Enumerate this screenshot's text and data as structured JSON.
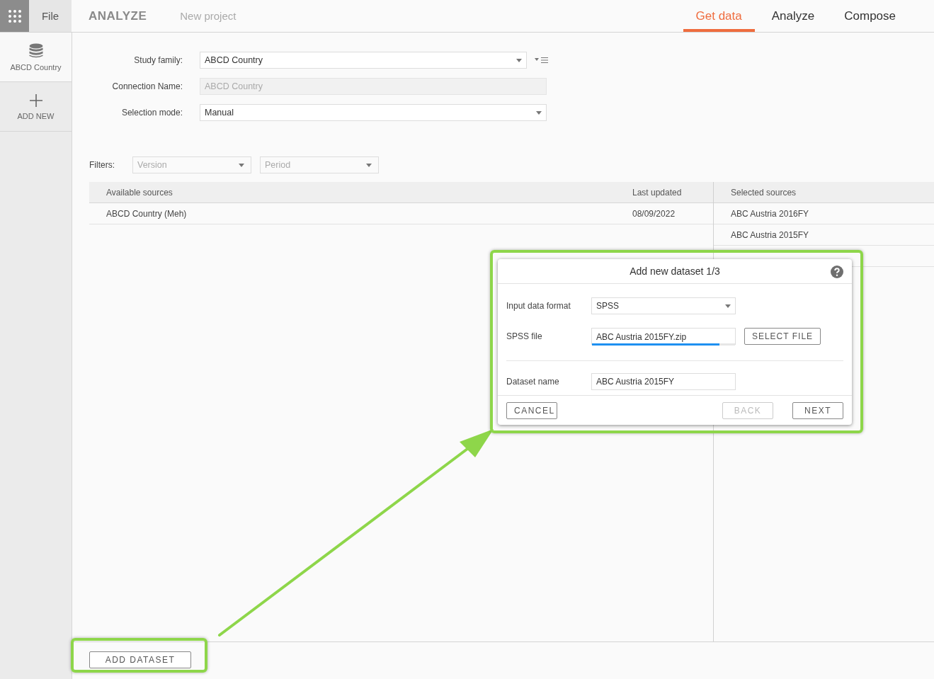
{
  "app_bar": {
    "file_menu": "File",
    "module": "ANALYZE",
    "project": "New project",
    "tabs": [
      {
        "label": "Get data",
        "selected": true
      },
      {
        "label": "Analyze",
        "selected": false
      },
      {
        "label": "Compose",
        "selected": false
      }
    ]
  },
  "sidebar": {
    "items": [
      {
        "label": "ABCD Country",
        "kind": "dataset",
        "selected": true
      },
      {
        "label": "ADD NEW",
        "kind": "add",
        "selected": false
      }
    ]
  },
  "form": {
    "fields": [
      {
        "label": "Study family:",
        "value": "ABCD Country",
        "kind": "dropdown",
        "disabled": false,
        "filter_button": true
      },
      {
        "label": "Connection Name:",
        "placeholder": "ABCD Country",
        "kind": "text",
        "disabled": true
      },
      {
        "label": "Selection mode:",
        "value": "Manual",
        "kind": "dropdown",
        "disabled": false
      }
    ]
  },
  "filters": {
    "label": "Filters:",
    "dropdowns": [
      {
        "placeholder": "Version"
      },
      {
        "placeholder": "Period"
      }
    ]
  },
  "available_sources": {
    "columns": [
      "Available sources",
      "Last updated"
    ],
    "rows": [
      [
        "ABCD Country (Meh)",
        "08/09/2022"
      ]
    ]
  },
  "selected_sources": {
    "heading": "Selected sources",
    "items": [
      "ABC Austria 2016FY",
      "ABC Austria 2015FY"
    ]
  },
  "add_dataset_button": "ADD DATASET",
  "dialog": {
    "title": "Add new dataset 1/3",
    "fields": [
      {
        "label": "Input data format",
        "value": "SPSS",
        "kind": "dropdown"
      },
      {
        "label": "SPSS file",
        "value": "ABC Austria 2015FY.zip",
        "kind": "file",
        "level": 0.89,
        "button": "SELECT FILE"
      },
      {
        "label": "Dataset name",
        "value": "ABC Austria 2015FY",
        "kind": "text"
      }
    ],
    "buttons": [
      {
        "label": "CANCEL",
        "disabled": false
      },
      {
        "label": "BACK",
        "disabled": true
      },
      {
        "label": "NEXT",
        "disabled": false
      }
    ]
  }
}
